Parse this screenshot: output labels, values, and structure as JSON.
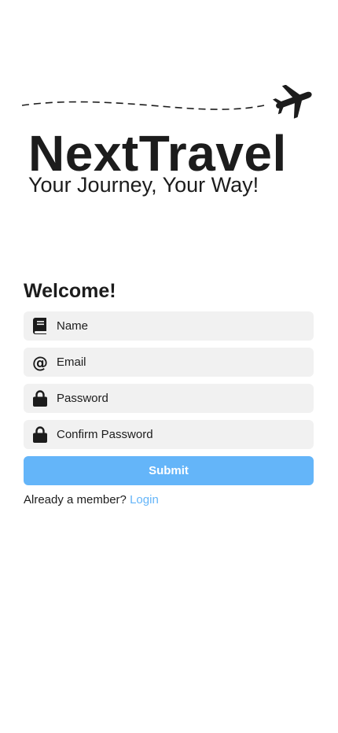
{
  "logo": {
    "brand_name": "NextTravel",
    "tagline": "Your Journey, Your Way!",
    "icon": "airplane-icon"
  },
  "form": {
    "heading": "Welcome!",
    "fields": [
      {
        "placeholder": "Name",
        "icon": "book-icon",
        "type": "text"
      },
      {
        "placeholder": "Email",
        "icon": "at-sign-icon",
        "type": "email"
      },
      {
        "placeholder": "Password",
        "icon": "lock-icon",
        "type": "password"
      },
      {
        "placeholder": "Confirm Password",
        "icon": "lock-icon",
        "type": "password"
      }
    ],
    "at_symbol": "@",
    "submit_label": "Submit",
    "member_prompt": "Already a member?",
    "login_link": "Login"
  },
  "colors": {
    "accent": "#64b5f9",
    "text": "#1c1c1c",
    "field_background": "#f1f1f1",
    "background": "#ffffff"
  }
}
